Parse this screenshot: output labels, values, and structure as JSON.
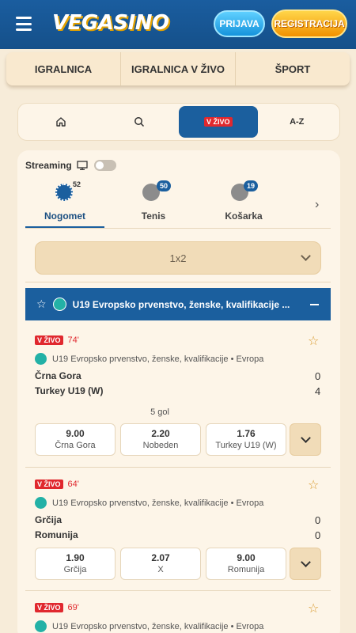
{
  "header": {
    "logo": "VEGASINO",
    "login_label": "PRIJAVA",
    "register_label": "REGISTRACIJA"
  },
  "main_nav": [
    {
      "label": "IGRALNICA"
    },
    {
      "label": "IGRALNICA V ŽIVO"
    },
    {
      "label": "ŠPORT"
    }
  ],
  "filter_bar": {
    "live_label": "V ŽIVO",
    "az_label": "A-Z"
  },
  "streaming_label": "Streaming",
  "sports": [
    {
      "label": "Nogomet",
      "count": "52",
      "active": true
    },
    {
      "label": "Tenis",
      "count": "50",
      "active": false
    },
    {
      "label": "Košarka",
      "count": "19",
      "active": false
    }
  ],
  "market_select": "1x2",
  "competition_title": "U19 Evropsko prvenstvo, ženske, kvalifikacije ...",
  "live_badge": "V ŽIVO",
  "matches": [
    {
      "minute": "74'",
      "competition": "U19 Evropsko prvenstvo, ženske, kvalifikacije • Evropa",
      "home": "Črna Gora",
      "away": "Turkey U19 (W)",
      "home_score": "0",
      "away_score": "4",
      "goals_note": "5 gol",
      "odds": [
        {
          "value": "9.00",
          "label": "Črna Gora"
        },
        {
          "value": "2.20",
          "label": "Nobeden"
        },
        {
          "value": "1.76",
          "label": "Turkey U19 (W)"
        }
      ]
    },
    {
      "minute": "64'",
      "competition": "U19 Evropsko prvenstvo, ženske, kvalifikacije • Evropa",
      "home": "Grčija",
      "away": "Romunija",
      "home_score": "0",
      "away_score": "0",
      "odds": [
        {
          "value": "1.90",
          "label": "Grčija"
        },
        {
          "value": "2.07",
          "label": "X"
        },
        {
          "value": "9.00",
          "label": "Romunija"
        }
      ]
    },
    {
      "minute": "69'",
      "competition": "U19 Evropsko prvenstvo, ženske, kvalifikacije • Evropa"
    }
  ],
  "colors": {
    "header_blue": "#15508a",
    "accent_blue": "#1b5f9e",
    "live_red": "#e0282e",
    "background": "#f7ecd9"
  }
}
